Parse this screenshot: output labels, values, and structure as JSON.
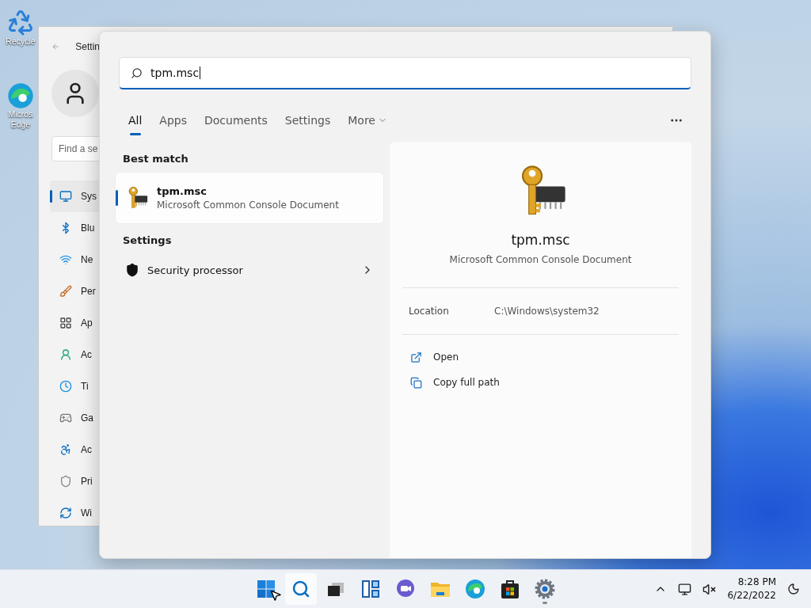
{
  "desktop_icons": [
    {
      "kind": "recycle",
      "label": [
        "Recycle"
      ]
    },
    {
      "kind": "edge",
      "label": [
        "Micros",
        "Edge"
      ]
    }
  ],
  "settings_window": {
    "title": "Settin",
    "search": {
      "placeholder": "Find a se"
    },
    "nav": [
      {
        "kind": "display",
        "label": "Sys",
        "selected": true
      },
      {
        "kind": "bluetooth",
        "label": "Blu",
        "selected": false
      },
      {
        "kind": "network",
        "label": "Ne",
        "selected": false
      },
      {
        "kind": "brush",
        "label": "Per",
        "selected": false
      },
      {
        "kind": "apps",
        "label": "Ap",
        "selected": false
      },
      {
        "kind": "account",
        "label": "Ac",
        "selected": false
      },
      {
        "kind": "time",
        "label": "Ti",
        "selected": false
      },
      {
        "kind": "gaming",
        "label": "Ga",
        "selected": false
      },
      {
        "kind": "accessibility",
        "label": "Ac",
        "selected": false
      },
      {
        "kind": "privacy",
        "label": "Pri",
        "selected": false
      },
      {
        "kind": "update",
        "label": "Wi",
        "selected": false
      }
    ]
  },
  "search_panel": {
    "query": "tpm.msc",
    "tabs": [
      {
        "label": "All",
        "selected": true
      },
      {
        "label": "Apps",
        "selected": false
      },
      {
        "label": "Documents",
        "selected": false
      },
      {
        "label": "Settings",
        "selected": false
      },
      {
        "label": "More",
        "selected": false,
        "dropdown": true
      }
    ],
    "sections": [
      {
        "heading": "Best match",
        "results": [
          {
            "kind": "file",
            "title": "tpm.msc",
            "subtitle": "Microsoft Common Console Document",
            "selected": true
          }
        ]
      },
      {
        "heading": "Settings",
        "results": [
          {
            "kind": "setting",
            "title": "Security processor"
          }
        ]
      }
    ],
    "detail": {
      "title": "tpm.msc",
      "subtitle": "Microsoft Common Console Document",
      "location_label": "Location",
      "location": "C:\\Windows\\system32",
      "actions": [
        {
          "kind": "open",
          "label": "Open"
        },
        {
          "kind": "copy",
          "label": "Copy full path"
        }
      ]
    }
  },
  "taskbar": {
    "apps": [
      {
        "kind": "start",
        "active": false,
        "running": false
      },
      {
        "kind": "search",
        "active": true,
        "running": false
      },
      {
        "kind": "taskview",
        "active": false,
        "running": false
      },
      {
        "kind": "widgets",
        "active": false,
        "running": false
      },
      {
        "kind": "chat",
        "active": false,
        "running": false
      },
      {
        "kind": "explorer",
        "active": false,
        "running": false
      },
      {
        "kind": "edge",
        "active": false,
        "running": false
      },
      {
        "kind": "store",
        "active": false,
        "running": false
      },
      {
        "kind": "settings",
        "active": false,
        "running": true
      }
    ],
    "time": "8:28 PM",
    "date": "6/22/2022"
  }
}
